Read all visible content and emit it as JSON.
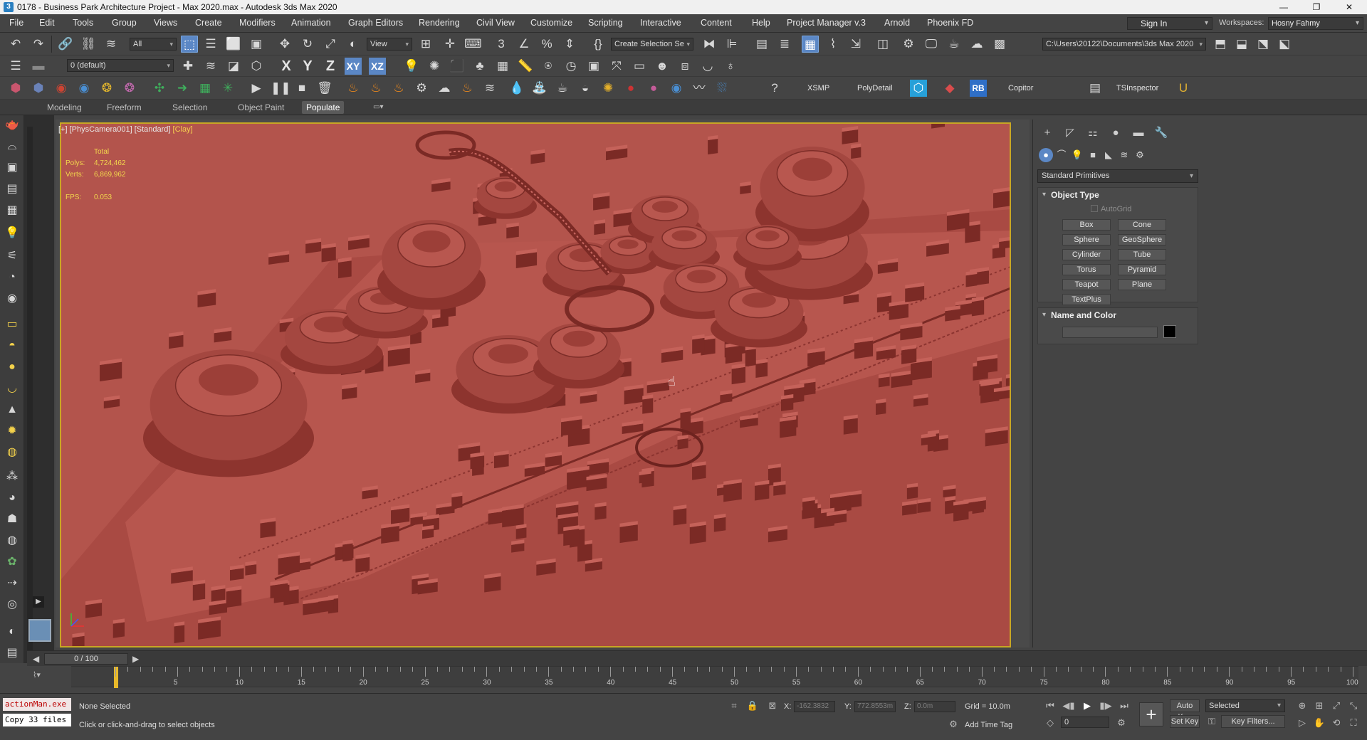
{
  "window": {
    "title": "0178 - Business Park Architecture Project - Max 2020.max - Autodesk 3ds Max 2020",
    "icon_name": "3dsmax-app-icon",
    "controls": [
      "minimize-icon",
      "maximize-icon",
      "close-icon"
    ],
    "control_glyphs": [
      "—",
      "❐",
      "✕"
    ]
  },
  "menu": {
    "items": [
      "File",
      "Edit",
      "Tools",
      "Group",
      "Views",
      "Create",
      "Modifiers",
      "Animation",
      "Graph Editors",
      "Rendering",
      "Civil View",
      "Customize",
      "Scripting",
      "Interactive",
      "Content",
      "Help",
      "Project Manager v.3",
      "Arnold",
      "Phoenix FD"
    ],
    "sign_in": "Sign In",
    "workspaces_label": "Workspaces:",
    "workspace_value": "Hosny Fahmy"
  },
  "toolbar": {
    "selection_filter": "All",
    "ref_coord": "View",
    "named_selection": "Create Selection Se",
    "project_path": "C:\\Users\\20122\\Documents\\3ds Max 2020",
    "layer": "0 (default)",
    "axis_x": "X",
    "axis_y": "Y",
    "axis_z": "Z",
    "axis_xy": "XY",
    "axis_xz": "XZ",
    "xsmp": "XSMP",
    "polydetail": "PolyDetail",
    "rb": "RB",
    "copitor": "Copitor",
    "tsinspector": "TSInspector"
  },
  "ribbon": {
    "tabs": [
      "Modeling",
      "Freeform",
      "Selection",
      "Object Paint",
      "Populate"
    ],
    "active": "Populate"
  },
  "viewport": {
    "label_plus": "[+]",
    "label_camera": "[PhysCamera001]",
    "label_mode": "[Standard]",
    "label_shading": "[Clay]",
    "stats_total": "Total",
    "stats_polys_label": "Polys:",
    "stats_polys": "4,724,462",
    "stats_verts_label": "Verts:",
    "stats_verts": "6,869,962",
    "stats_fps_label": "FPS:",
    "stats_fps": "0.053",
    "clay_color": "#b3544c",
    "frame_color": "#c8a624"
  },
  "command_panel": {
    "dropdown": "Standard Primitives",
    "object_type_title": "Object Type",
    "autogrid": "AutoGrid",
    "primitives": [
      "Box",
      "Cone",
      "Sphere",
      "GeoSphere",
      "Cylinder",
      "Tube",
      "Torus",
      "Pyramid",
      "Teapot",
      "Plane",
      "TextPlus"
    ],
    "name_color_title": "Name and Color",
    "object_color": "#000000"
  },
  "timeline": {
    "frame_display": "0 / 100",
    "ticks": [
      5,
      10,
      15,
      20,
      25,
      30,
      35,
      40,
      45,
      50,
      55,
      60,
      65,
      70,
      75,
      80,
      85,
      90,
      95,
      100
    ]
  },
  "status": {
    "maxscript_line1": "actionMan.exe",
    "maxscript_line2": "Copy 33 files",
    "selection": "None Selected",
    "prompt": "Click or click-and-drag to select objects",
    "x_label": "X:",
    "x_value": "-162.3832",
    "y_label": "Y:",
    "y_value": "772.8553m",
    "z_label": "Z:",
    "z_value": "0.0m",
    "grid": "Grid = 10.0m",
    "add_time_tag": "Add Time Tag",
    "auto_key": "Auto Key",
    "set_key": "Set Key",
    "key_set": "Selected",
    "key_filters": "Key Filters...",
    "current_frame": "0"
  }
}
